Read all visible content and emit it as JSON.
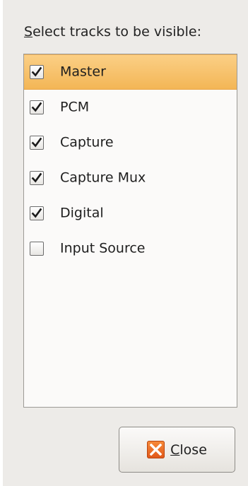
{
  "dialog": {
    "prompt_mnemonic": "S",
    "prompt_rest": "elect tracks to be visible:",
    "close_mnemonic": "C",
    "close_rest": "lose"
  },
  "tracks": [
    {
      "label": "Master",
      "checked": true,
      "selected": true
    },
    {
      "label": "PCM",
      "checked": true,
      "selected": false
    },
    {
      "label": "Capture",
      "checked": true,
      "selected": false
    },
    {
      "label": "Capture Mux",
      "checked": true,
      "selected": false
    },
    {
      "label": "Digital",
      "checked": true,
      "selected": false
    },
    {
      "label": "Input Source",
      "checked": false,
      "selected": false
    }
  ],
  "icons": {
    "close": "close-icon",
    "check": "check-icon"
  },
  "colors": {
    "selection": "#f5bd63",
    "close_icon": "#e8651f",
    "dialog_bg": "#edebe8"
  }
}
